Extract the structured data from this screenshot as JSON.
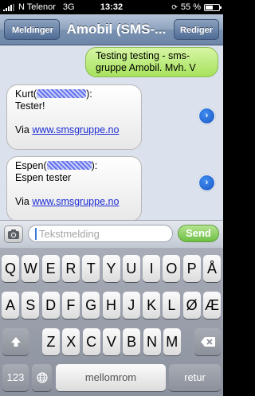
{
  "status_bar": {
    "carrier": "N Telenor",
    "network": "3G",
    "time": "13:32",
    "battery": "55 %",
    "battery_level": 0.55
  },
  "nav": {
    "back_label": "Meldinger",
    "title": "Amobil (SMS-...",
    "edit_label": "Rediger"
  },
  "messages": [
    {
      "direction": "sent",
      "text": "Testing testing - sms-gruppe Amobil. Mvh. V"
    },
    {
      "direction": "received",
      "sender": "Kurt(",
      "sender_suffix": "):",
      "body": "Tester!",
      "via_prefix": "Via",
      "via_link": "www.smsgruppe.no"
    },
    {
      "direction": "received",
      "sender": "Espen(",
      "sender_suffix": "):",
      "body": "Espen tester",
      "via_prefix": "Via",
      "via_link": "www.smsgruppe.no"
    }
  ],
  "input": {
    "placeholder": "Tekstmelding",
    "send_label": "Send"
  },
  "keyboard": {
    "row1": [
      "Q",
      "W",
      "E",
      "R",
      "T",
      "Y",
      "U",
      "I",
      "O",
      "P",
      "Å"
    ],
    "row2": [
      "A",
      "S",
      "D",
      "F",
      "G",
      "H",
      "J",
      "K",
      "L",
      "Ø",
      "Æ"
    ],
    "row3": [
      "Z",
      "X",
      "C",
      "V",
      "B",
      "N",
      "M"
    ],
    "numbers_label": "123",
    "space_label": "mellomrom",
    "return_label": "retur"
  }
}
